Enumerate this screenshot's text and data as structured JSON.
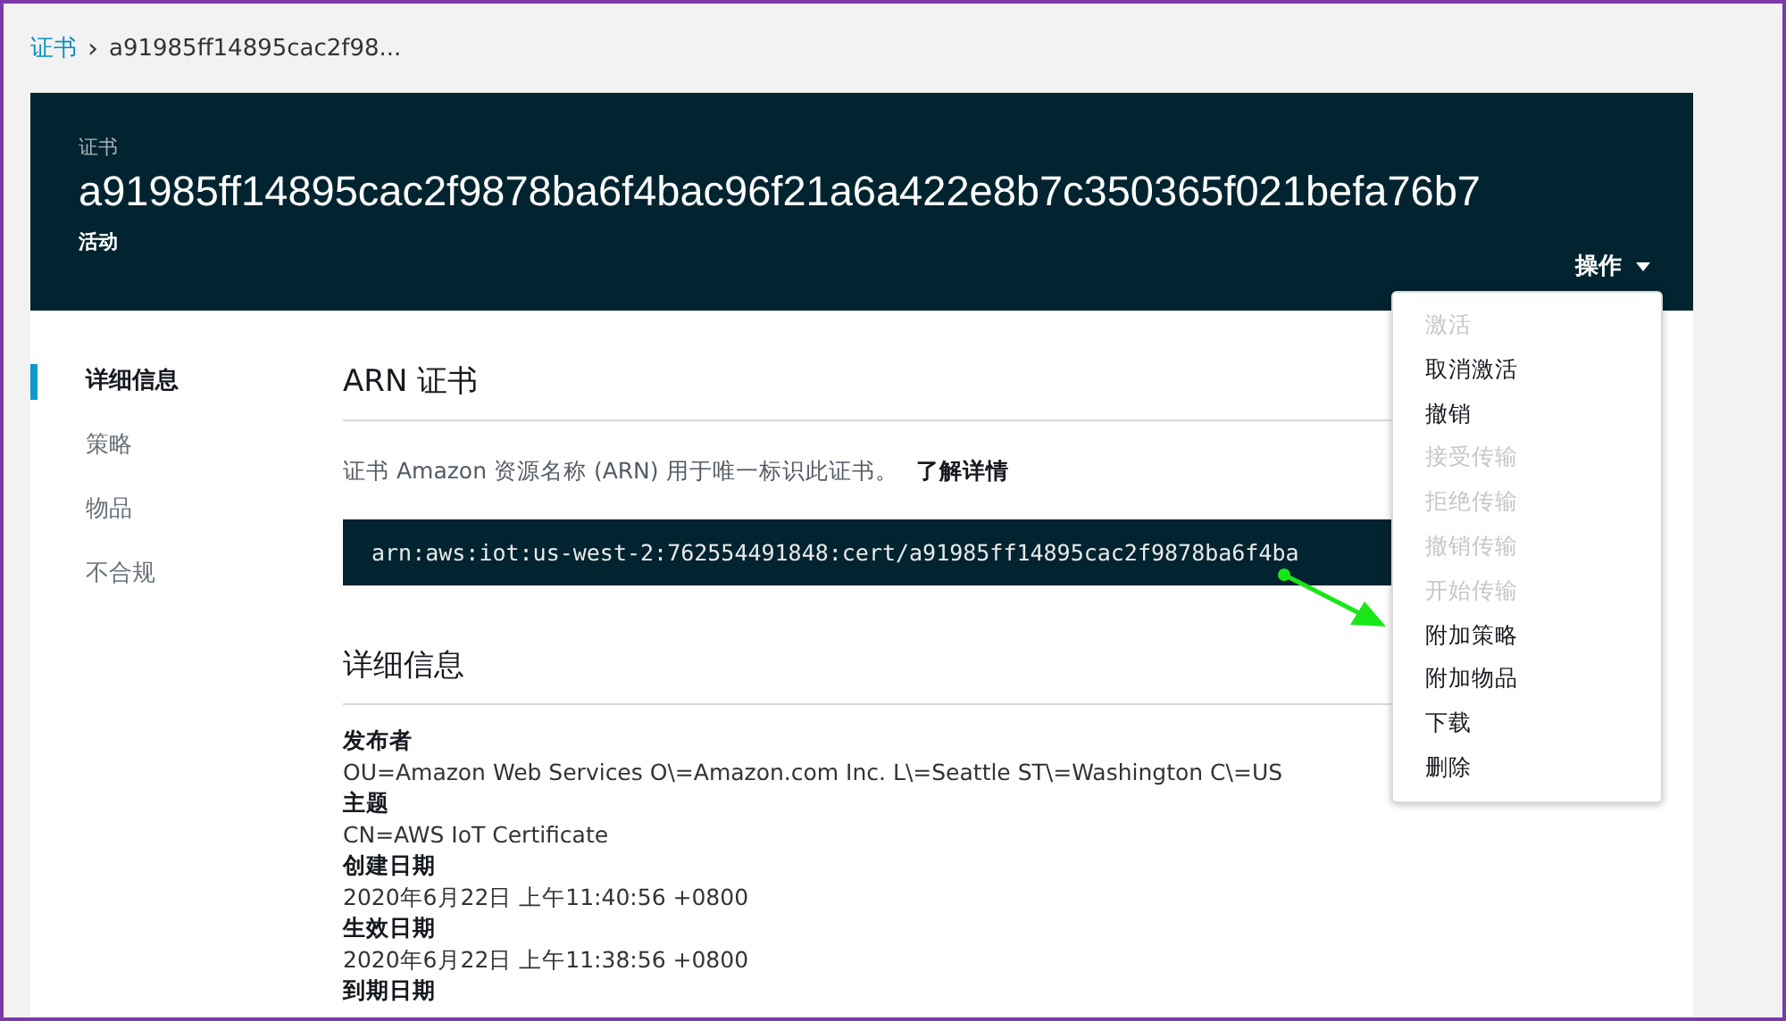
{
  "breadcrumb": {
    "link": "证书",
    "separator": "›",
    "current": "a91985ff14895cac2f98..."
  },
  "header": {
    "overline": "证书",
    "title": "a91985ff14895cac2f9878ba6f4bac96f21a6a422e8b7c350365f021befa76b7",
    "status": "活动",
    "actions_label": "操作"
  },
  "sidebar": {
    "items": [
      {
        "label": "详细信息",
        "selected": true
      },
      {
        "label": "策略",
        "selected": false
      },
      {
        "label": "物品",
        "selected": false
      },
      {
        "label": "不合规",
        "selected": false
      }
    ]
  },
  "arn_section": {
    "heading": "ARN 证书",
    "description": "证书 Amazon 资源名称 (ARN) 用于唯一标识此证书。",
    "learn_more": "了解详情",
    "arn": "arn:aws:iot:us-west-2:762554491848:cert/a91985ff14895cac2f9878ba6f4ba"
  },
  "details_section": {
    "heading": "详细信息",
    "fields": [
      {
        "label": "发布者",
        "value": "OU=Amazon Web Services O\\=Amazon.com Inc. L\\=Seattle ST\\=Washington C\\=US"
      },
      {
        "label": "主题",
        "value": "CN=AWS IoT Certificate"
      },
      {
        "label": "创建日期",
        "value": "2020年6月22日 上午11:40:56 +0800"
      },
      {
        "label": "生效日期",
        "value": "2020年6月22日 上午11:38:56 +0800"
      },
      {
        "label": "到期日期"
      }
    ]
  },
  "actions_menu": {
    "items": [
      {
        "label": "激活",
        "disabled": true
      },
      {
        "label": "取消激活",
        "disabled": false
      },
      {
        "label": "撤销",
        "disabled": false
      },
      {
        "label": "接受传输",
        "disabled": true
      },
      {
        "label": "拒绝传输",
        "disabled": true
      },
      {
        "label": "撤销传输",
        "disabled": true
      },
      {
        "label": "开始传输",
        "disabled": true
      },
      {
        "label": "附加策略",
        "disabled": false
      },
      {
        "label": "附加物品",
        "disabled": false
      },
      {
        "label": "下载",
        "disabled": false
      },
      {
        "label": "删除",
        "disabled": false
      }
    ]
  }
}
